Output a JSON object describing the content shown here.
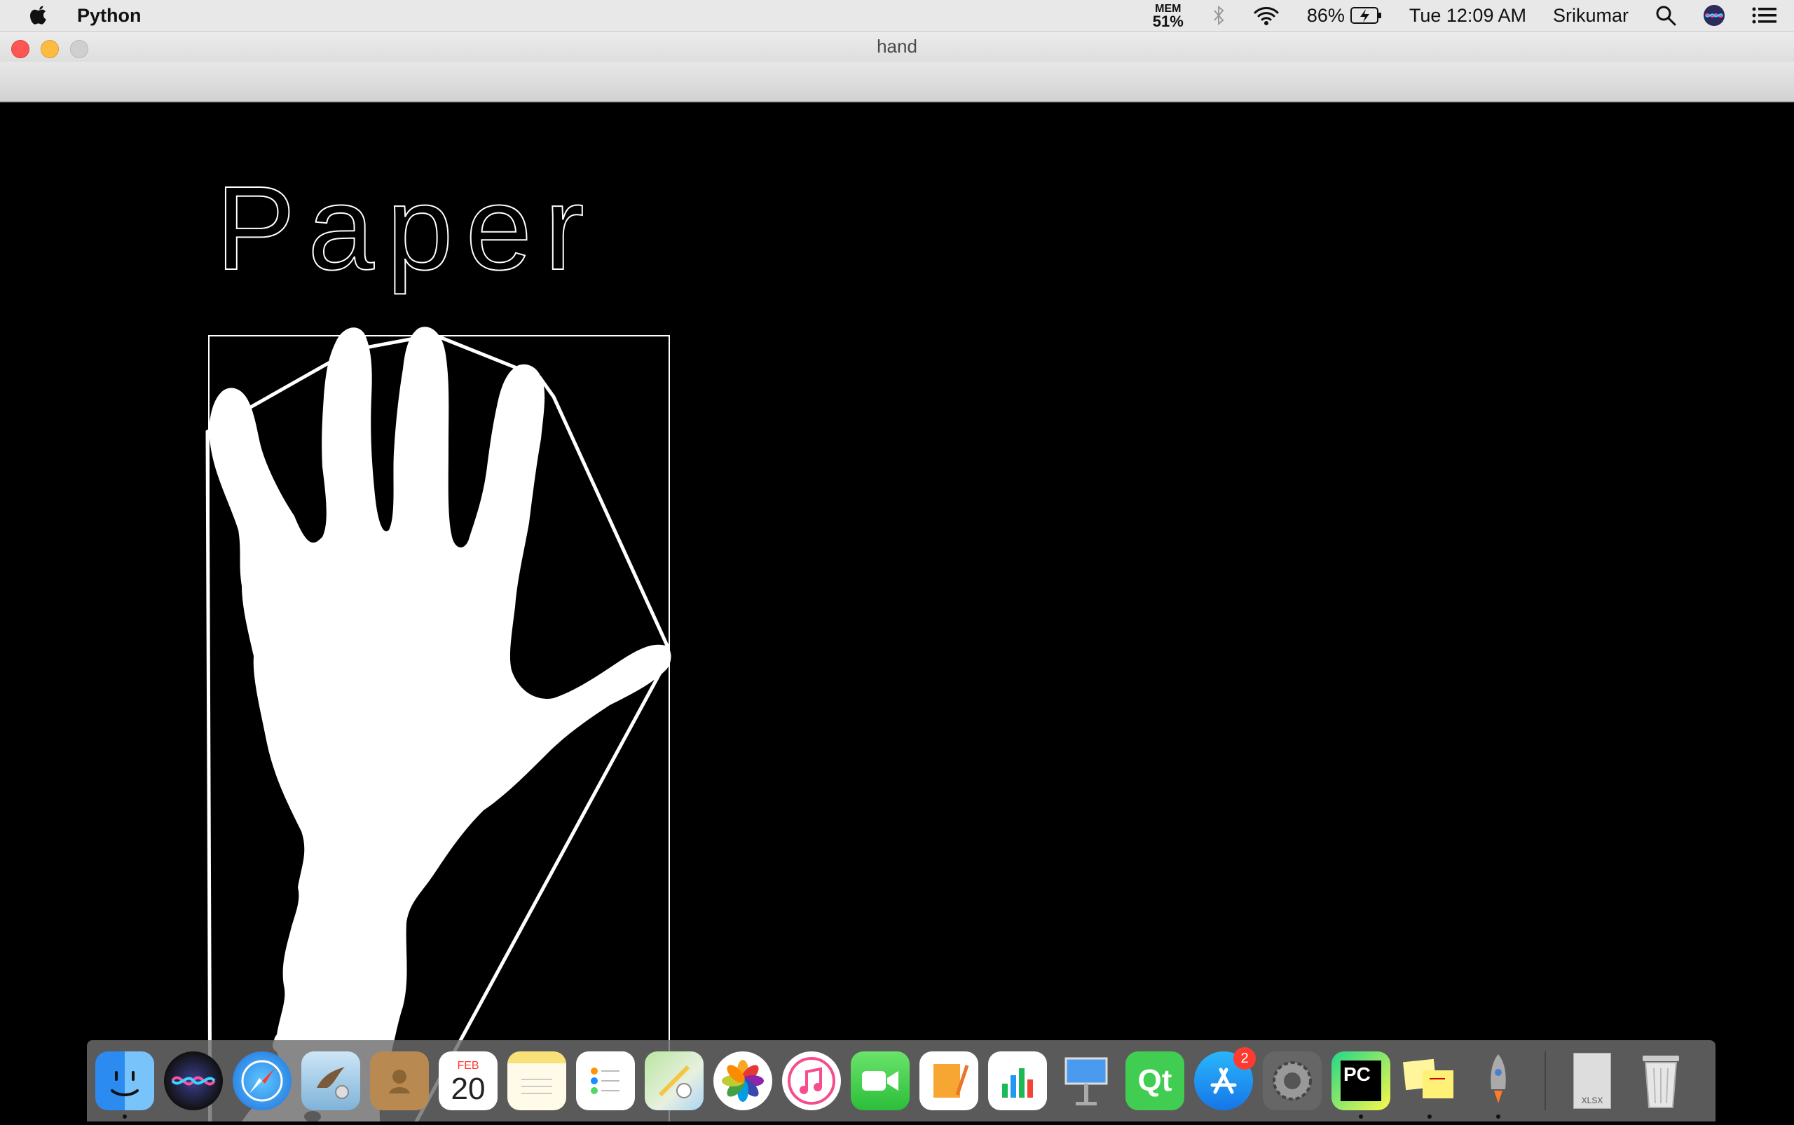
{
  "menubar": {
    "app_name": "Python",
    "mem_label": "MEM",
    "mem_value": "51%",
    "battery": "86%",
    "clock": "Tue 12:09 AM",
    "user": "Srikumar"
  },
  "window": {
    "title": "hand"
  },
  "video": {
    "gesture_label": "Paper"
  },
  "dock": {
    "calendar_month": "FEB",
    "calendar_day": "20",
    "appstore_badge": "2",
    "pycharm_label": "PC",
    "qt_label": "Qt",
    "xlsx_label": "XLSX"
  }
}
